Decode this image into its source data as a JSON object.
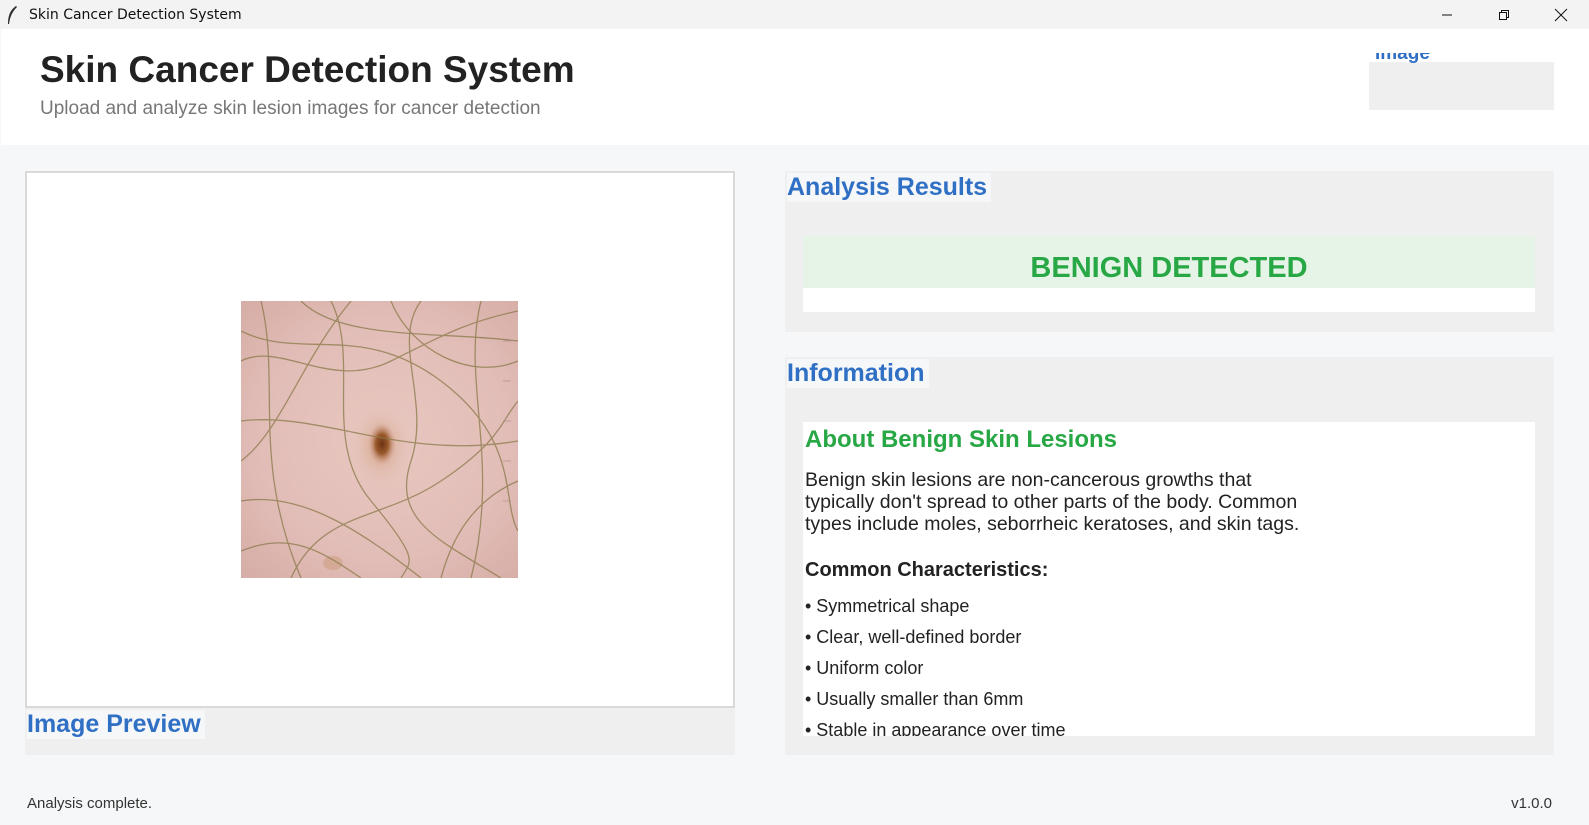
{
  "window": {
    "title": "Skin Cancer Detection System",
    "controls": [
      "minimize-icon",
      "restore-icon",
      "close-icon"
    ]
  },
  "header": {
    "title": "Skin Cancer Detection System",
    "subtitle": "Upload and analyze skin lesion images for cancer detection",
    "upload_button_label": "Image"
  },
  "preview": {
    "label": "Image Preview",
    "image_description_icon": "skin-lesion-image"
  },
  "results": {
    "label": "Analysis Results",
    "verdict": "BENIGN DETECTED"
  },
  "information": {
    "label": "Information",
    "title": "About Benign Skin Lesions",
    "description": "Benign skin lesions are non-cancerous growths that typically don't spread to other parts of the body. Common types include moles, seborrheic keratoses, and skin tags.",
    "characteristics_heading": "Common Characteristics:",
    "characteristics": [
      "• Symmetrical shape",
      "• Clear, well-defined border",
      "• Uniform color",
      "• Usually smaller than 6mm",
      "• Stable in appearance over time"
    ]
  },
  "status_bar": {
    "message": "Analysis complete.",
    "version": "v1.0.0"
  },
  "colors": {
    "accent_blue": "#2f6fc4",
    "benign_green": "#28a745",
    "benign_band": "#e6f4e8"
  }
}
